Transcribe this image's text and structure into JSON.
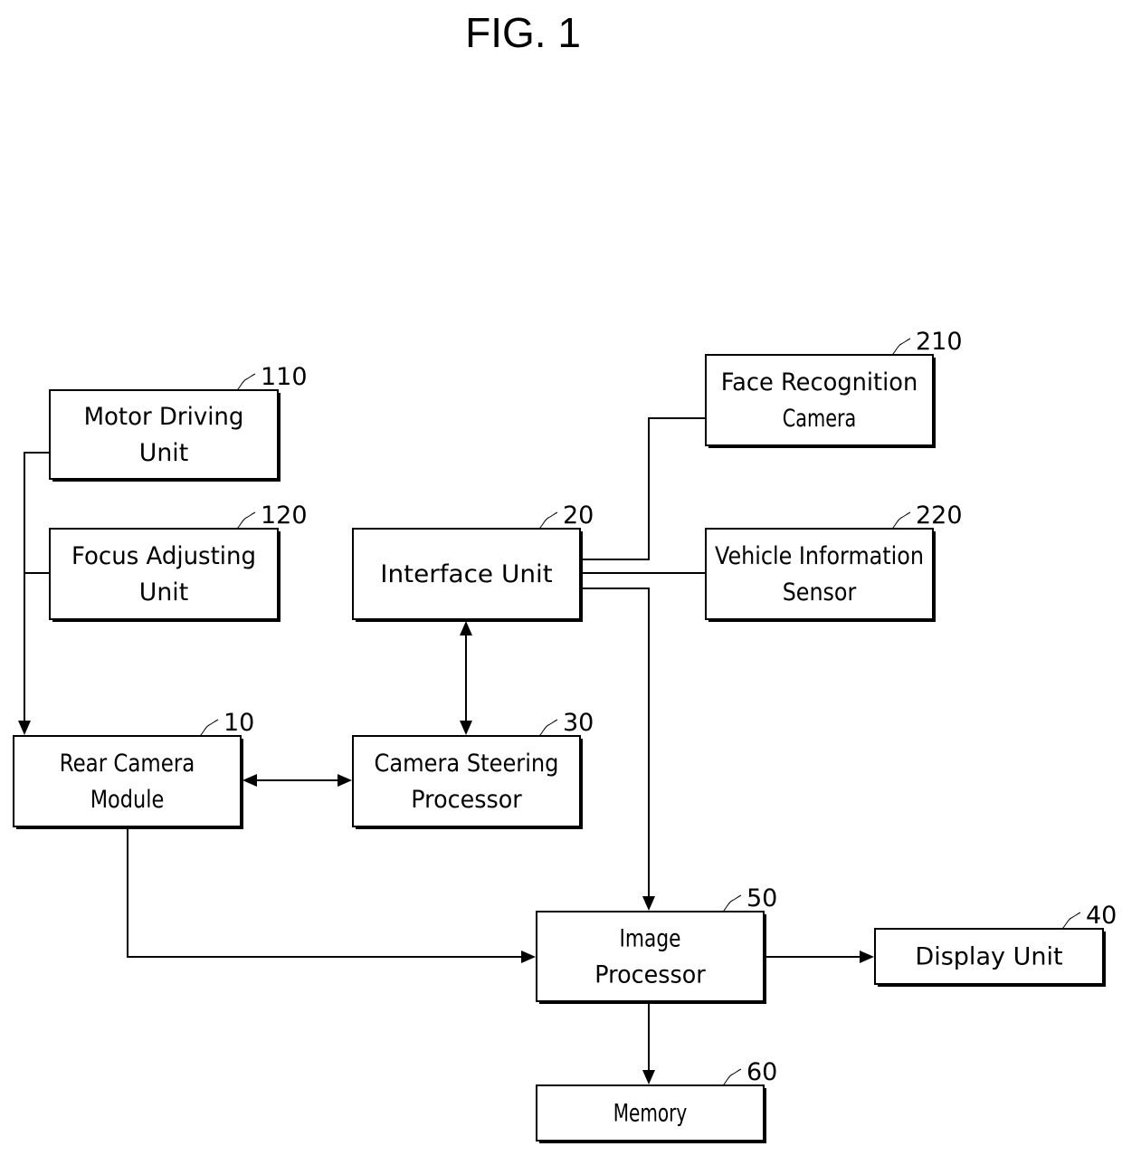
{
  "figure": {
    "title": "FIG. 1",
    "blocks": [
      {
        "id": "motor",
        "ref": "110",
        "lines": [
          "Motor Driving",
          "Unit"
        ]
      },
      {
        "id": "focus",
        "ref": "120",
        "lines": [
          "Focus Adjusting",
          "Unit"
        ]
      },
      {
        "id": "interface",
        "ref": "20",
        "lines": [
          "Interface Unit"
        ]
      },
      {
        "id": "face",
        "ref": "210",
        "lines": [
          "Face Recognition",
          "Camera"
        ]
      },
      {
        "id": "vehicle",
        "ref": "220",
        "lines": [
          "Vehicle Information",
          "Sensor"
        ]
      },
      {
        "id": "rear",
        "ref": "10",
        "lines": [
          "Rear Camera",
          "Module"
        ]
      },
      {
        "id": "steer",
        "ref": "30",
        "lines": [
          "Camera Steering",
          "Processor"
        ]
      },
      {
        "id": "image",
        "ref": "50",
        "lines": [
          "Image",
          "Processor"
        ]
      },
      {
        "id": "display",
        "ref": "40",
        "lines": [
          "Display Unit"
        ]
      },
      {
        "id": "memory",
        "ref": "60",
        "lines": [
          "Memory"
        ]
      }
    ],
    "connections": [
      {
        "from": "motor",
        "to": "rear",
        "type": "arrow"
      },
      {
        "from": "focus",
        "to": "rear",
        "type": "arrow"
      },
      {
        "from": "interface",
        "to": "steer",
        "type": "bidirectional"
      },
      {
        "from": "interface",
        "to": "face",
        "type": "line"
      },
      {
        "from": "interface",
        "to": "vehicle",
        "type": "line"
      },
      {
        "from": "interface",
        "to": "image",
        "type": "arrow"
      },
      {
        "from": "rear",
        "to": "steer",
        "type": "bidirectional"
      },
      {
        "from": "rear",
        "to": "image",
        "type": "arrow"
      },
      {
        "from": "image",
        "to": "display",
        "type": "arrow"
      },
      {
        "from": "image",
        "to": "memory",
        "type": "arrow"
      }
    ]
  }
}
